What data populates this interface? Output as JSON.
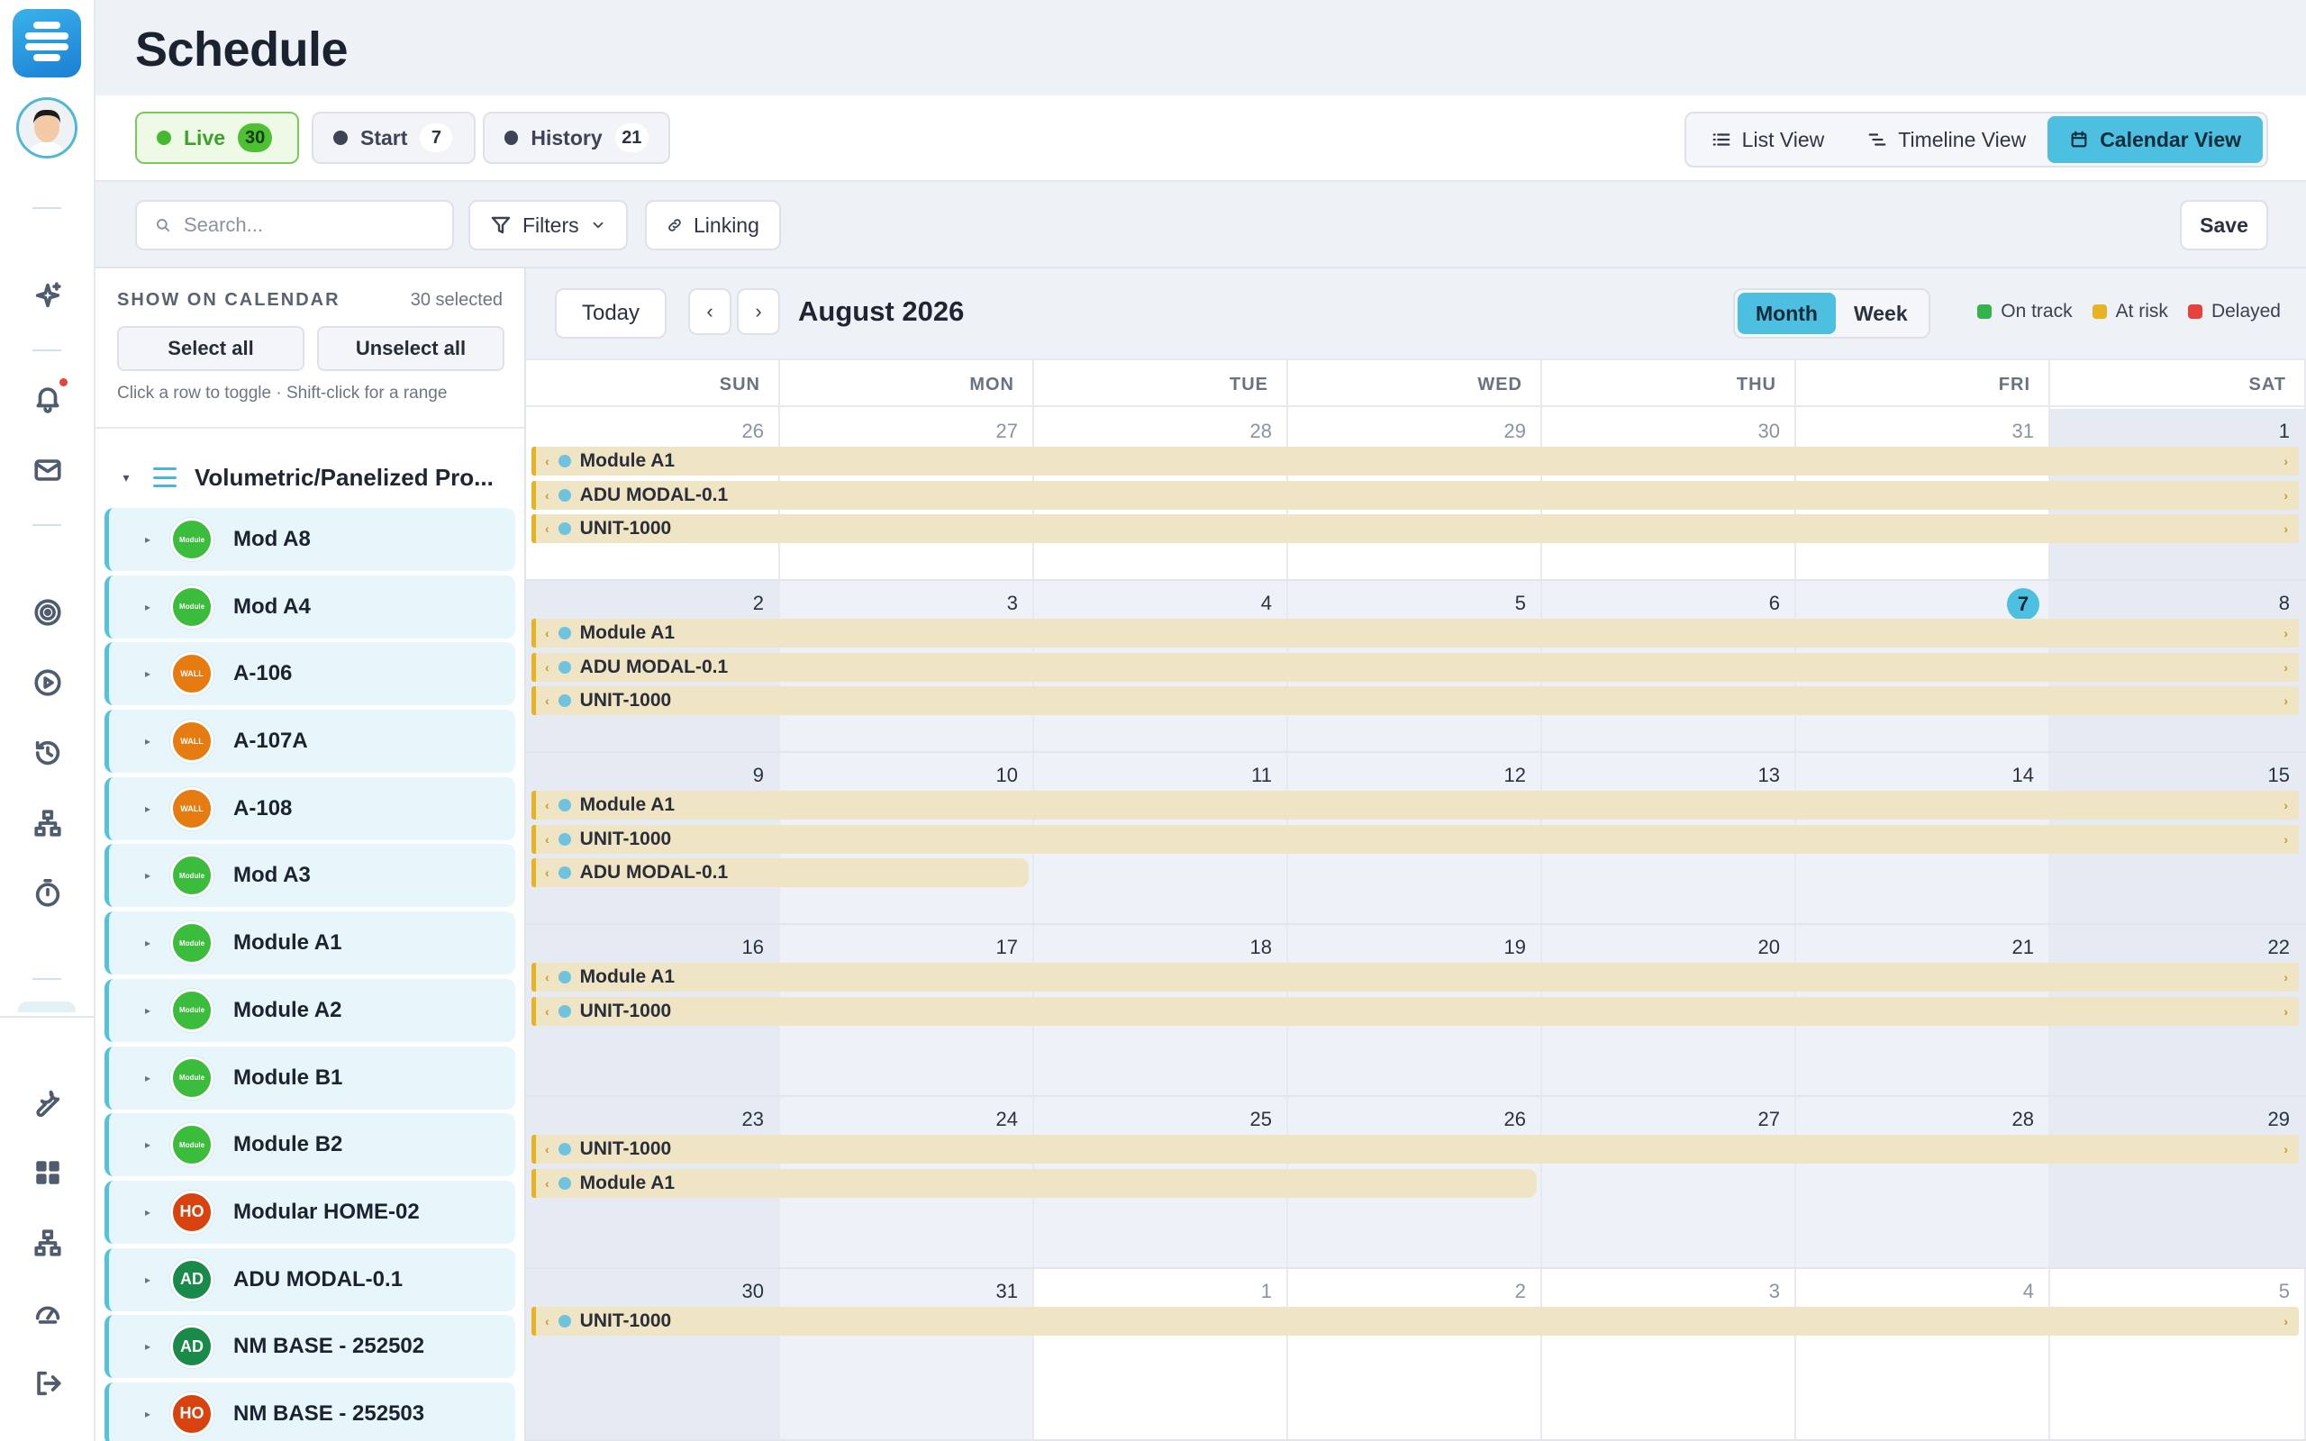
{
  "page": {
    "title": "Schedule"
  },
  "status_tabs": [
    {
      "label": "Live",
      "count": "30"
    },
    {
      "label": "Start",
      "count": "7"
    },
    {
      "label": "History",
      "count": "21"
    }
  ],
  "views": {
    "list": "List View",
    "timeline": "Timeline View",
    "calendar": "Calendar View",
    "active": "Calendar View"
  },
  "toolbar": {
    "search_placeholder": "Search...",
    "filters": "Filters",
    "linking": "Linking",
    "save": "Save"
  },
  "panel": {
    "heading": "SHOW ON CALENDAR",
    "selected": "30 selected",
    "select_all": "Select all",
    "unselect_all": "Unselect all",
    "hint": "Click a row to toggle · Shift-click for a range",
    "group": "Volumetric/Panelized Pro...",
    "items": [
      {
        "name": "Mod A8",
        "badge": "Module",
        "type": "module"
      },
      {
        "name": "Mod A4",
        "badge": "Module",
        "type": "module"
      },
      {
        "name": "A-106",
        "badge": "WALL",
        "type": "wall"
      },
      {
        "name": "A-107A",
        "badge": "WALL",
        "type": "wall"
      },
      {
        "name": "A-108",
        "badge": "WALL",
        "type": "wall"
      },
      {
        "name": "Mod A3",
        "badge": "Module",
        "type": "module"
      },
      {
        "name": "Module A1",
        "badge": "Module",
        "type": "module"
      },
      {
        "name": "Module A2",
        "badge": "Module",
        "type": "module"
      },
      {
        "name": "Module B1",
        "badge": "Module",
        "type": "module"
      },
      {
        "name": "Module B2",
        "badge": "Module",
        "type": "module"
      },
      {
        "name": "Modular HOME-02",
        "badge": "HO",
        "type": "ho"
      },
      {
        "name": "ADU MODAL-0.1",
        "badge": "AD",
        "type": "ad"
      },
      {
        "name": "NM BASE - 252502",
        "badge": "AD",
        "type": "ad"
      },
      {
        "name": "NM BASE - 252503",
        "badge": "HO",
        "type": "ho"
      }
    ]
  },
  "calendar": {
    "today_label": "Today",
    "prev": "‹",
    "next": "›",
    "month_title": "August 2026",
    "mode_month": "Month",
    "mode_week": "Week",
    "legend": [
      {
        "label": "On track",
        "color": "#34b34a"
      },
      {
        "label": "At risk",
        "color": "#e8b322"
      },
      {
        "label": "Delayed",
        "color": "#e8413b"
      }
    ],
    "weekdays": [
      "SUN",
      "MON",
      "TUE",
      "WED",
      "THU",
      "FRI",
      "SAT"
    ],
    "today_date": "7",
    "weeks": [
      {
        "dates": [
          "26",
          "27",
          "28",
          "29",
          "30",
          "31",
          "1"
        ],
        "out": [
          true,
          true,
          true,
          true,
          true,
          true,
          false
        ],
        "events": [
          {
            "label": "Module A1",
            "start": 0,
            "end": 6,
            "cont": true
          },
          {
            "label": "ADU MODAL-0.1",
            "start": 0,
            "end": 6,
            "cont": true
          },
          {
            "label": "UNIT-1000",
            "start": 0,
            "end": 6,
            "cont": true
          }
        ]
      },
      {
        "dates": [
          "2",
          "3",
          "4",
          "5",
          "6",
          "7",
          "8"
        ],
        "out": [
          false,
          false,
          false,
          false,
          false,
          false,
          false
        ],
        "events": [
          {
            "label": "Module A1",
            "start": 0,
            "end": 6,
            "cont": true
          },
          {
            "label": "ADU MODAL-0.1",
            "start": 0,
            "end": 6,
            "cont": true
          },
          {
            "label": "UNIT-1000",
            "start": 0,
            "end": 6,
            "cont": true
          }
        ]
      },
      {
        "dates": [
          "9",
          "10",
          "11",
          "12",
          "13",
          "14",
          "15"
        ],
        "out": [
          false,
          false,
          false,
          false,
          false,
          false,
          false
        ],
        "events": [
          {
            "label": "Module A1",
            "start": 0,
            "end": 6,
            "cont": true
          },
          {
            "label": "UNIT-1000",
            "start": 0,
            "end": 6,
            "cont": true
          },
          {
            "label": "ADU MODAL-0.1",
            "start": 0,
            "end": 1,
            "cont": false
          }
        ]
      },
      {
        "dates": [
          "16",
          "17",
          "18",
          "19",
          "20",
          "21",
          "22"
        ],
        "out": [
          false,
          false,
          false,
          false,
          false,
          false,
          false
        ],
        "events": [
          {
            "label": "Module A1",
            "start": 0,
            "end": 6,
            "cont": true
          },
          {
            "label": "UNIT-1000",
            "start": 0,
            "end": 6,
            "cont": true
          }
        ]
      },
      {
        "dates": [
          "23",
          "24",
          "25",
          "26",
          "27",
          "28",
          "29"
        ],
        "out": [
          false,
          false,
          false,
          false,
          false,
          false,
          false
        ],
        "events": [
          {
            "label": "UNIT-1000",
            "start": 0,
            "end": 6,
            "cont": true
          },
          {
            "label": "Module A1",
            "start": 0,
            "end": 3,
            "cont": false
          }
        ]
      },
      {
        "dates": [
          "30",
          "31",
          "1",
          "2",
          "3",
          "4",
          "5"
        ],
        "out": [
          false,
          false,
          true,
          true,
          true,
          true,
          true
        ],
        "events": [
          {
            "label": "UNIT-1000",
            "start": 0,
            "end": 6,
            "cont": true
          }
        ]
      }
    ]
  },
  "icons": {
    "rail": [
      "logo-icon",
      "avatar",
      "sparkle-icon",
      "bell-icon",
      "mail-icon",
      "target-icon",
      "play-icon",
      "history-icon",
      "network-icon",
      "timer-icon",
      "wrench-icon",
      "grid-icon",
      "sitemap-icon",
      "gauge-icon",
      "logout-icon"
    ]
  }
}
